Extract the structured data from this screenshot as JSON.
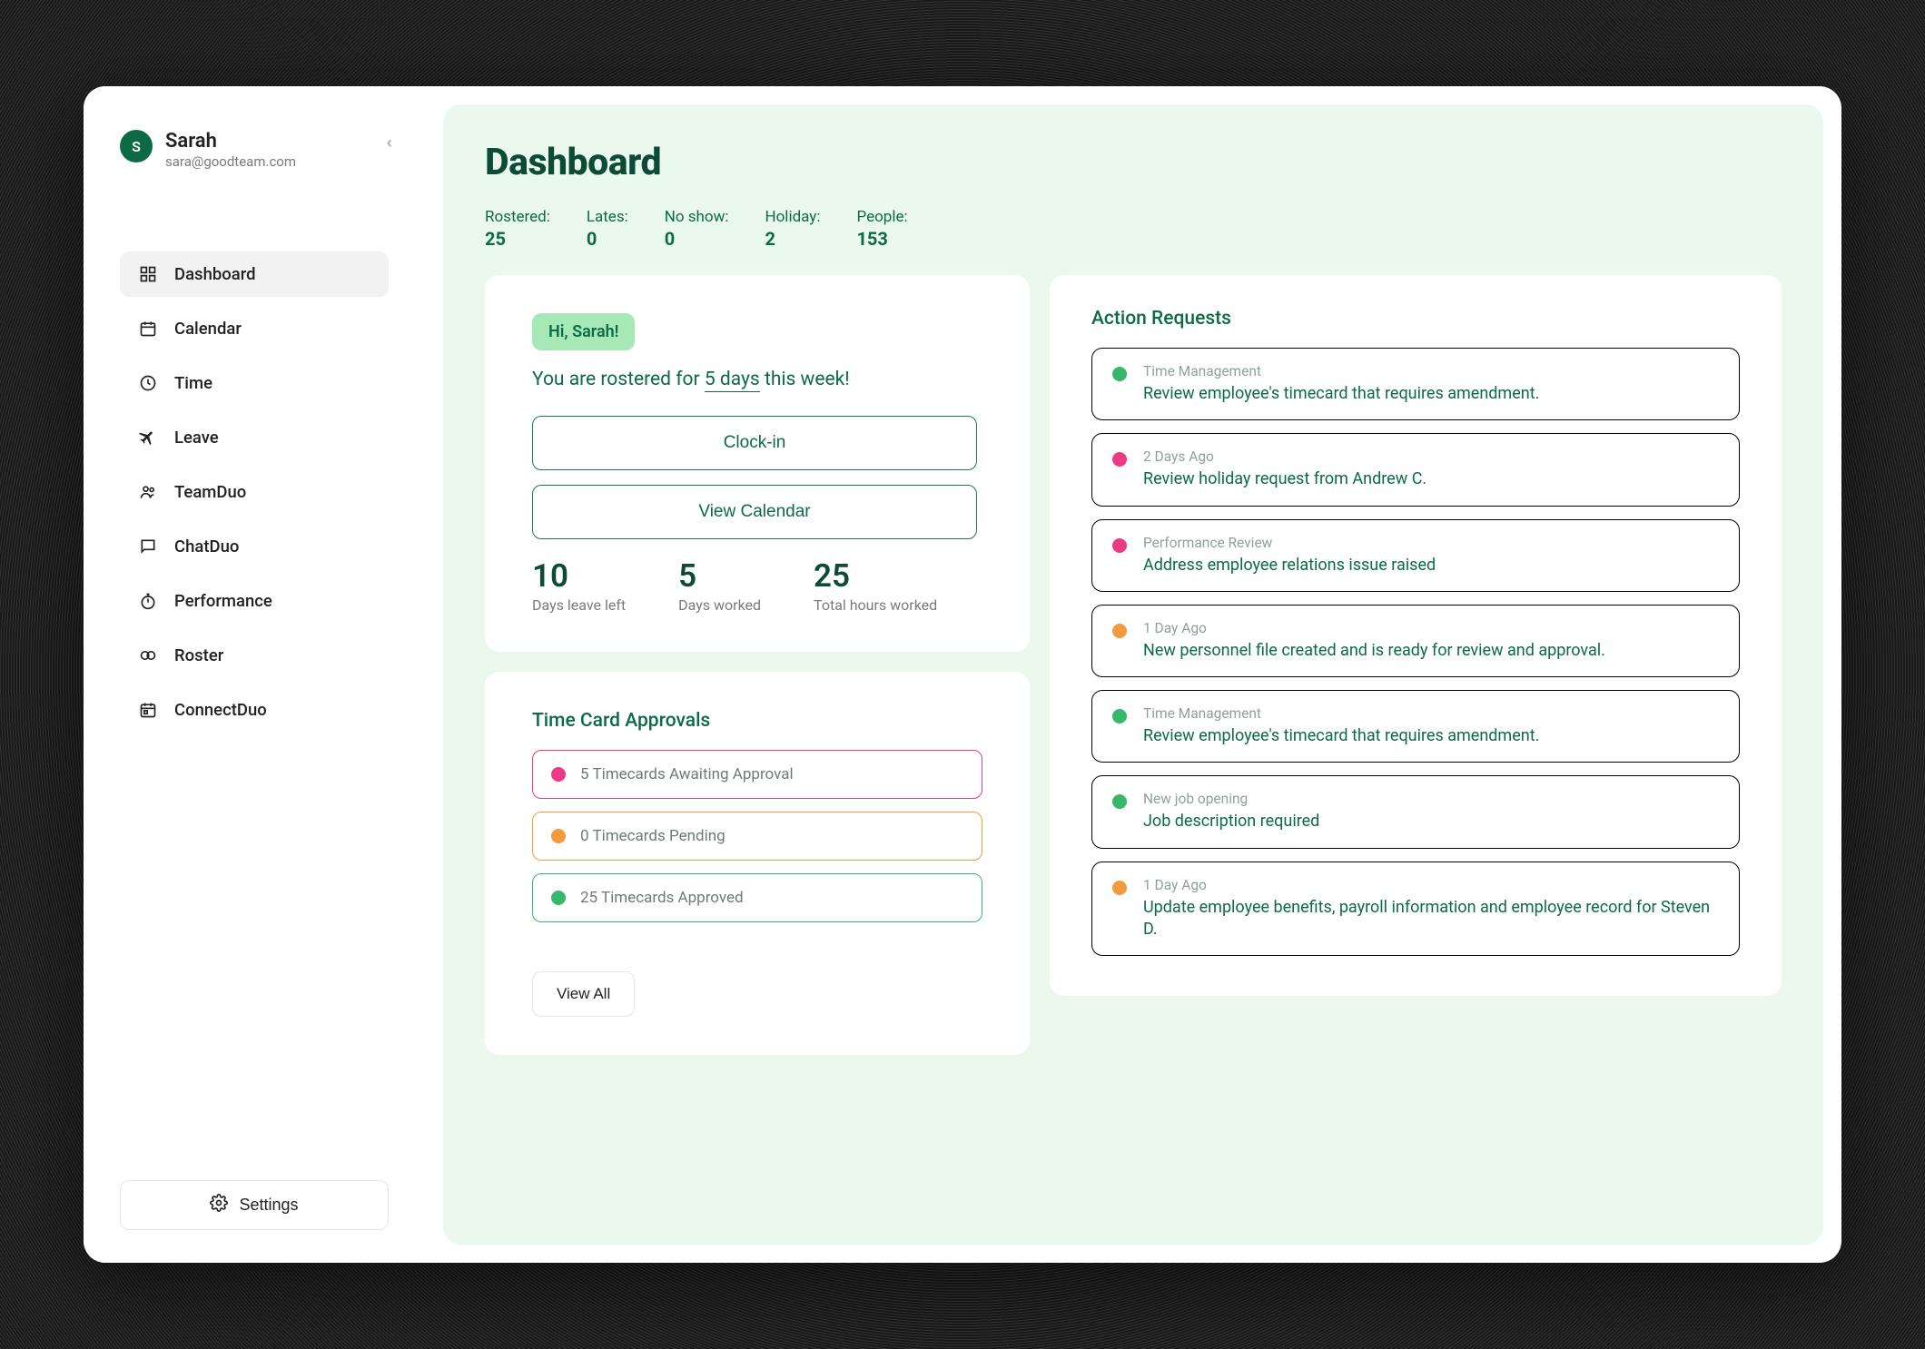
{
  "user": {
    "initial": "S",
    "name": "Sarah",
    "email": "sara@goodteam.com"
  },
  "sidebar": {
    "items": [
      {
        "id": "dashboard",
        "label": "Dashboard",
        "active": true
      },
      {
        "id": "calendar",
        "label": "Calendar"
      },
      {
        "id": "time",
        "label": "Time"
      },
      {
        "id": "leave",
        "label": "Leave"
      },
      {
        "id": "teamduo",
        "label": "TeamDuo"
      },
      {
        "id": "chatduo",
        "label": "ChatDuo"
      },
      {
        "id": "performance",
        "label": "Performance"
      },
      {
        "id": "roster",
        "label": "Roster"
      },
      {
        "id": "connectduo",
        "label": "ConnectDuo"
      }
    ],
    "settings_label": "Settings"
  },
  "page_title": "Dashboard",
  "stats": {
    "rostered": {
      "label": "Rostered:",
      "value": "25"
    },
    "lates": {
      "label": "Lates:",
      "value": "0"
    },
    "noshow": {
      "label": "No show:",
      "value": "0"
    },
    "holiday": {
      "label": "Holiday:",
      "value": "2"
    },
    "people": {
      "label": "People:",
      "value": "153"
    }
  },
  "greeting": {
    "pill": "Hi, Sarah!",
    "line_prefix": "You are rostered for ",
    "line_days": "5 days",
    "line_suffix": " this week!",
    "clockin_label": "Clock-in",
    "calendar_label": "View Calendar",
    "metrics": {
      "leave": {
        "num": "10",
        "lbl": "Days leave left"
      },
      "worked": {
        "num": "5",
        "lbl": "Days worked"
      },
      "hours": {
        "num": "25",
        "lbl": "Total hours worked"
      }
    }
  },
  "timecard": {
    "title": "Time Card Approvals",
    "rows": [
      {
        "color": "pink",
        "text": "5 Timecards Awaiting Approval"
      },
      {
        "color": "orange",
        "text": "0 Timecards Pending"
      },
      {
        "color": "green",
        "text": "25 Timecards Approved"
      }
    ],
    "view_all": "View All"
  },
  "actions": {
    "title": "Action Requests",
    "items": [
      {
        "color": "green",
        "meta": "Time Management",
        "body": "Review employee's timecard that requires amendment."
      },
      {
        "color": "pink",
        "meta": "2 Days Ago",
        "body": "Review holiday request from Andrew C."
      },
      {
        "color": "pink",
        "meta": "Performance Review",
        "body": "Address employee relations issue raised"
      },
      {
        "color": "orange",
        "meta": "1 Day Ago",
        "body": "New personnel file created and is ready for review and approval."
      },
      {
        "color": "green",
        "meta": "Time Management",
        "body": "Review employee's timecard that requires amendment."
      },
      {
        "color": "green",
        "meta": "New job opening",
        "body": "Job description required"
      },
      {
        "color": "orange",
        "meta": "1 Day Ago",
        "body": "Update employee benefits, payroll information and employee record for Steven D."
      }
    ]
  },
  "colors": {
    "pink": "#ec3a84",
    "orange": "#f29b3e",
    "green": "#37b76a",
    "brand": "#0c6b44"
  }
}
